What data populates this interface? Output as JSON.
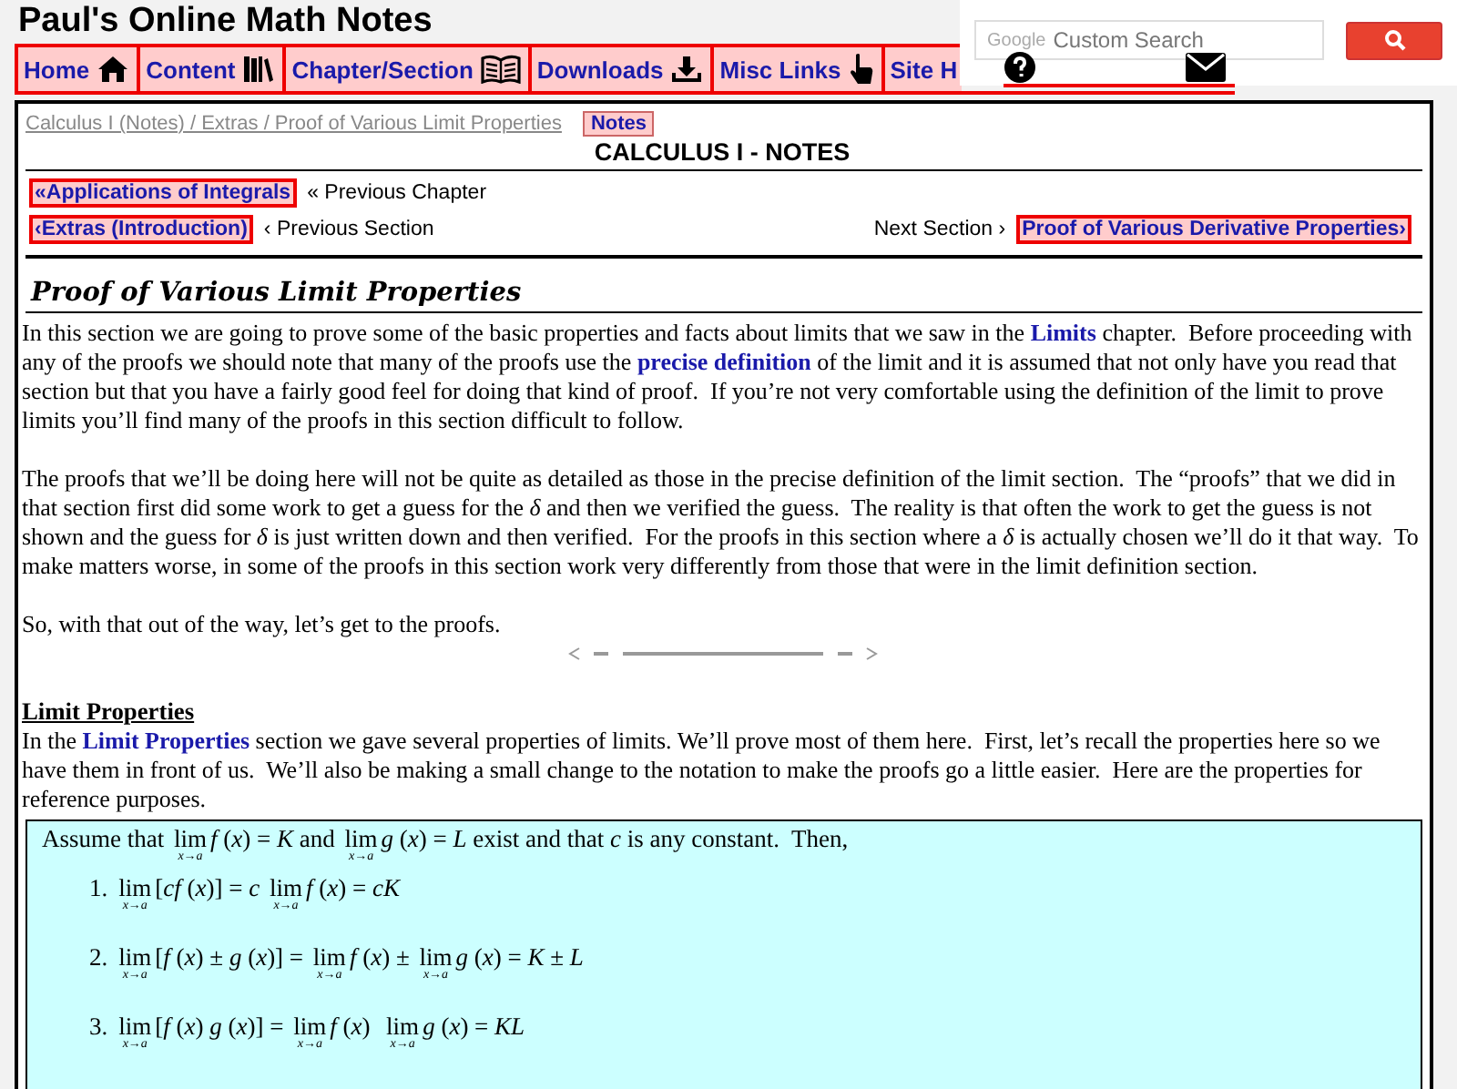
{
  "site_title": "Paul's Online Math Notes",
  "nav": [
    {
      "label": "Home"
    },
    {
      "label": "Content"
    },
    {
      "label": "Chapter/Section"
    },
    {
      "label": "Downloads"
    },
    {
      "label": "Misc Links"
    },
    {
      "label": "Site H"
    }
  ],
  "search": {
    "brand": "Google",
    "placeholder": "Custom Search"
  },
  "breadcrumb": "Calculus I (Notes) / Extras / Proof of Various Limit Properties",
  "badge": "Notes",
  "course_title": "CALCULUS I - NOTES",
  "prev_chapter": {
    "link": "«Applications of Integrals",
    "label": "« Previous Chapter"
  },
  "prev_section": {
    "link": "‹Extras (Introduction)",
    "label": "‹ Previous Section"
  },
  "next_section": {
    "label": "Next Section ›",
    "link": "Proof of Various Derivative Properties›"
  },
  "section_title": "Proof of Various Limit Properties",
  "intro": [
    [
      {
        "kind": "text",
        "text": "In this section we are going to prove some of the basic properties and facts about limits that we saw in the "
      },
      {
        "kind": "link",
        "text": "Limits"
      },
      {
        "kind": "text",
        "text": " chapter.  Before proceeding with any of the proofs we should note that many of the proofs use the "
      },
      {
        "kind": "link",
        "text": "precise definition"
      },
      {
        "kind": "text",
        "text": " of the limit and it is assumed that not only have you read that section but that you have a fairly good feel for doing that kind of proof.  If you’re not very comfortable using the definition of the limit to prove limits you’ll find many of the proofs in this section difficult to follow."
      }
    ],
    [
      {
        "kind": "text",
        "text": "The proofs that we’ll be doing here will not be quite as detailed as those in the precise definition of the limit section.  The “proofs” that we did in that section first did some work to get a guess for the *δ* and then we verified the guess.  The reality is that often the work to get the guess is not shown and the guess for *δ* is just written down and then verified.  For the proofs in this section where a *δ* is actually chosen we’ll do it that way.  To make matters worse, in some of the proofs in this section work very differently from those that were in the limit definition section."
      }
    ],
    [
      {
        "kind": "text",
        "text": "So, with that out of the way, let’s get to the proofs."
      }
    ]
  ],
  "subheading": "Limit Properties",
  "limit_intro": [
    {
      "kind": "text",
      "text": "In the "
    },
    {
      "kind": "link",
      "text": "Limit Properties"
    },
    {
      "kind": "text",
      "text": " section we gave several properties of limits. We’ll prove most of them here.  First, let’s recall the properties here so we have them in front of us.  We’ll also be making a small change to the notation to make the proofs go a little easier.  Here are the properties for reference purposes."
    }
  ],
  "box": {
    "lead": [
      {
        "kind": "text",
        "text": "Assume that "
      },
      {
        "kind": "lim",
        "text": "x→a"
      },
      {
        "kind": "text",
        "text": "*f* (*x*) = *K* and "
      },
      {
        "kind": "lim",
        "text": "x→a"
      },
      {
        "kind": "text",
        "text": "*g* (*x*) = *L* exist and that *c* is any constant.  Then,"
      }
    ],
    "items": [
      {
        "num": "1.",
        "parts": [
          {
            "kind": "lim",
            "text": "x→a"
          },
          {
            "kind": "text",
            "text": "[*cf* (*x*)] = *c* "
          },
          {
            "kind": "lim",
            "text": "x→a"
          },
          {
            "kind": "text",
            "text": "*f* (*x*) = *cK*"
          }
        ]
      },
      {
        "num": "2.",
        "parts": [
          {
            "kind": "lim",
            "text": "x→a"
          },
          {
            "kind": "text",
            "text": "[*f* (*x*) ± *g* (*x*)] = "
          },
          {
            "kind": "lim",
            "text": "x→a"
          },
          {
            "kind": "text",
            "text": "*f* (*x*) ± "
          },
          {
            "kind": "lim",
            "text": "x→a"
          },
          {
            "kind": "text",
            "text": "*g* (*x*) = *K* ± *L*"
          }
        ]
      },
      {
        "num": "3.",
        "parts": [
          {
            "kind": "lim",
            "text": "x→a"
          },
          {
            "kind": "text",
            "text": "[*f* (*x*) *g* (*x*)] = "
          },
          {
            "kind": "lim",
            "text": "x→a"
          },
          {
            "kind": "text",
            "text": "*f* (*x*)  "
          },
          {
            "kind": "lim",
            "text": "x→a"
          },
          {
            "kind": "text",
            "text": "*g* (*x*) = *KL*"
          }
        ]
      }
    ]
  }
}
